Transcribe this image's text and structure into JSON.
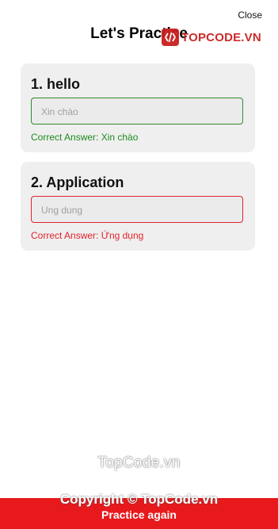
{
  "header": {
    "title": "Let's Practice",
    "close_label": "Close"
  },
  "watermark": {
    "logo_text": "TOPCODE.VN",
    "center_text": "TopCode.vn",
    "copyright": "Copyright © TopCode.vn"
  },
  "questions": [
    {
      "title": "1. hello",
      "answer": "Xin chào",
      "feedback": "Correct Answer: Xin chào",
      "status": "correct"
    },
    {
      "title": "2. Application",
      "answer": "Ung dung",
      "feedback": "Correct Answer: Ứng dụng",
      "status": "wrong"
    }
  ],
  "footer": {
    "button_label": "Practice again"
  },
  "colors": {
    "correct": "#2e8b2e",
    "wrong": "#e0232a",
    "button_bg": "#e8191c",
    "card_bg": "#efefef"
  }
}
